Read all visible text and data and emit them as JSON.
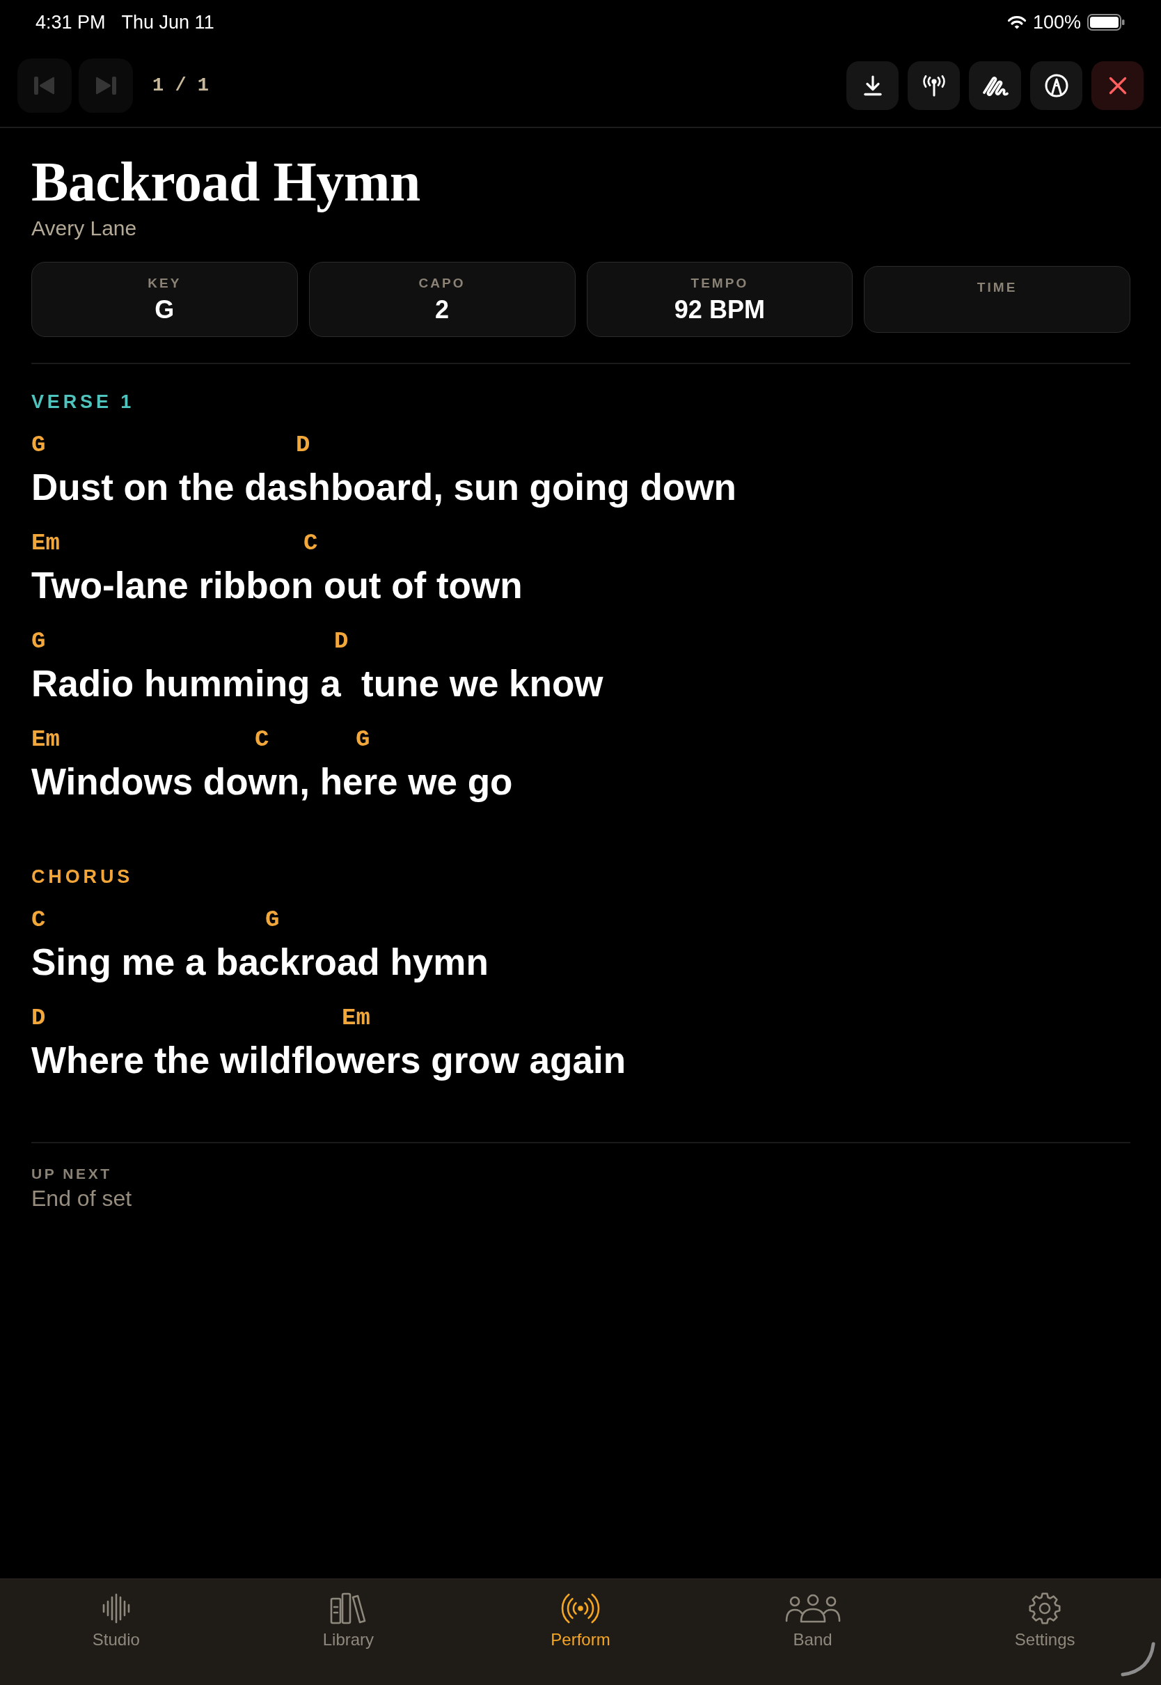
{
  "status_bar": {
    "time": "4:31 PM",
    "date": "Thu Jun 11",
    "battery": "100%"
  },
  "toolbar": {
    "previous_button": {
      "disabled": true
    },
    "next_button": {
      "disabled": true
    },
    "page": "1 / 1"
  },
  "song": {
    "title": "Backroad Hymn",
    "artist": "Avery Lane",
    "details": [
      {
        "label": "KEY",
        "value": "G"
      },
      {
        "label": "CAPO",
        "value": "2"
      },
      {
        "label": "TEMPO",
        "value": "92 BPM"
      },
      {
        "label": "TIME"
      }
    ]
  },
  "sections": [
    {
      "label": "VERSE 1",
      "color": "#4fc4be",
      "lines": [
        {
          "chords": [
            "G",
            "D"
          ],
          "lyric": "Dust on the dashboard, sun going down"
        },
        {
          "chords": [
            "Em",
            "C"
          ],
          "lyric": "Two-lane ribbon out of town"
        },
        {
          "chords": [
            "G",
            "D"
          ],
          "lyric": "Radio humming a  tune we know"
        },
        {
          "chords": [
            "Em",
            "C",
            "G"
          ],
          "lyric": "Windows down, here we go"
        }
      ]
    },
    {
      "label": "CHORUS",
      "color": "#f2a63a",
      "lines": [
        {
          "chords": [
            "C",
            "G"
          ],
          "lyric": "Sing me a backroad hymn"
        },
        {
          "chords": [
            "D",
            "Em"
          ],
          "lyric": "Where the wildflowers grow again"
        }
      ]
    }
  ],
  "up_next": {
    "label": "UP NEXT",
    "value": "End of set"
  },
  "tab_bar": {
    "tabs": [
      {
        "label": "Studio",
        "selected": false
      },
      {
        "label": "Library",
        "selected": false
      },
      {
        "label": "Perform",
        "selected": true
      },
      {
        "label": "Band",
        "selected": false
      },
      {
        "label": "Settings",
        "selected": false
      }
    ]
  }
}
